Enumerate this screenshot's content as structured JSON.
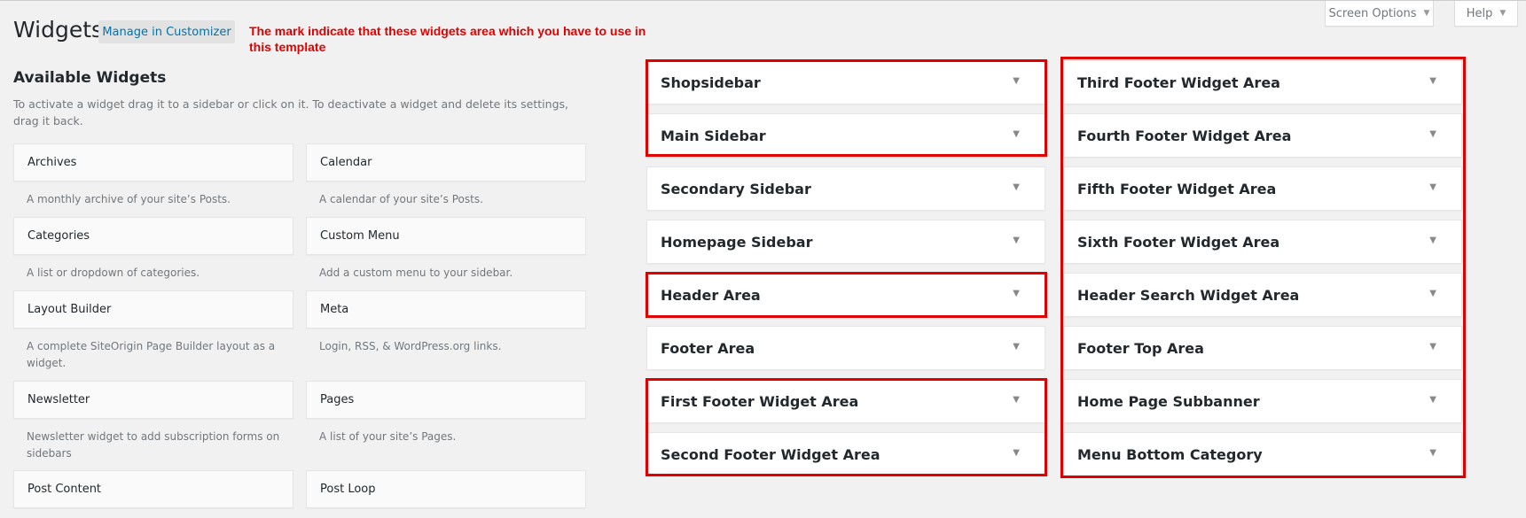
{
  "header": {
    "title": "Widgets",
    "customize_label": "Manage in Customizer",
    "note": "The mark indicate that these widgets area which you have to use in this template",
    "screen_options_label": "Screen Options",
    "help_label": "Help"
  },
  "available": {
    "title": "Available Widgets",
    "description": "To activate a widget drag it to a sidebar or click on it. To deactivate a widget and delete its settings, drag it back.",
    "widgets": [
      {
        "name": "Archives",
        "description": "A monthly archive of your site’s Posts."
      },
      {
        "name": "Calendar",
        "description": "A calendar of your site’s Posts."
      },
      {
        "name": "Categories",
        "description": "A list or dropdown of categories."
      },
      {
        "name": "Custom Menu",
        "description": "Add a custom menu to your sidebar."
      },
      {
        "name": "Layout Builder",
        "description": "A complete SiteOrigin Page Builder layout as a widget."
      },
      {
        "name": "Meta",
        "description": "Login, RSS, & WordPress.org links."
      },
      {
        "name": "Newsletter",
        "description": "Newsletter widget to add subscription forms on sidebars"
      },
      {
        "name": "Pages",
        "description": "A list of your site’s Pages."
      },
      {
        "name": "Post Content",
        "description": ""
      },
      {
        "name": "Post Loop",
        "description": ""
      }
    ]
  },
  "sidebars": {
    "left": [
      "Shopsidebar",
      "Main Sidebar",
      "Secondary Sidebar",
      "Homepage Sidebar",
      "Header Area",
      "Footer Area",
      "First Footer Widget Area",
      "Second Footer Widget Area"
    ],
    "right": [
      "Third Footer Widget Area",
      "Fourth Footer Widget Area",
      "Fifth Footer Widget Area",
      "Sixth Footer Widget Area",
      "Header Search Widget Area",
      "Footer Top Area",
      "Home Page Subbanner",
      "Menu Bottom Category"
    ]
  },
  "colors": {
    "mark": "#e00000",
    "link": "#0073aa",
    "background": "#f1f1f1"
  }
}
